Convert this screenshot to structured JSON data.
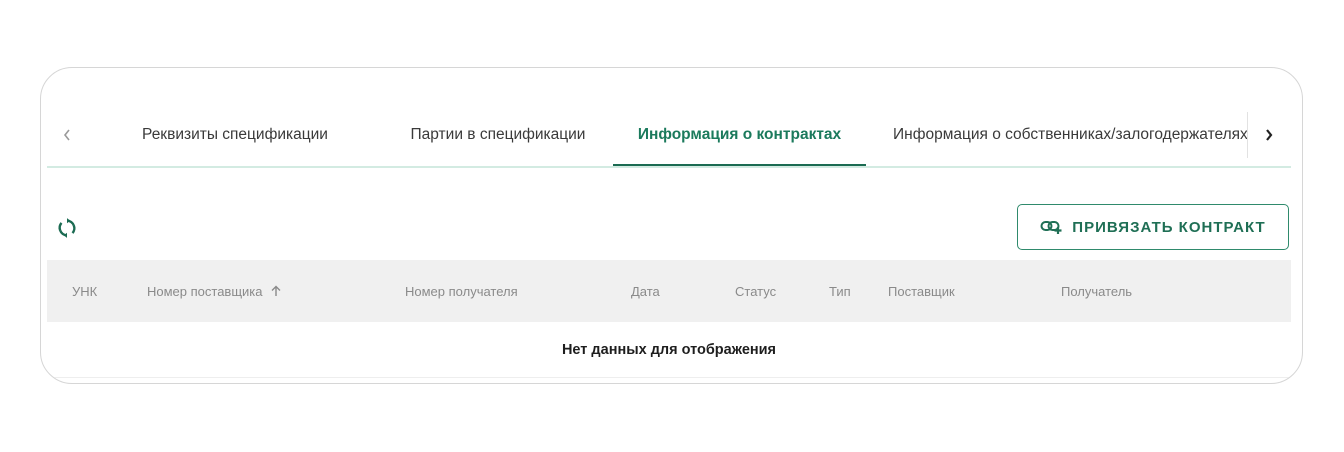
{
  "tabs": {
    "items": [
      {
        "label": "Реквизиты спецификации"
      },
      {
        "label": "Партии в спецификации"
      },
      {
        "label": "Информация о контрактах"
      },
      {
        "label": "Информация о собственниках/залогодержателях/за"
      }
    ],
    "active_index": 2,
    "left_arrow_icon": "chevron-left-icon",
    "right_arrow_icon": "chevron-right-icon"
  },
  "toolbar": {
    "refresh_icon": "refresh-icon",
    "link_contract_label": "ПРИВЯЗАТЬ КОНТРАКТ",
    "link_contract_icon": "link-add-icon"
  },
  "table": {
    "columns": [
      {
        "label": "УНК"
      },
      {
        "label": "Номер поставщика",
        "sort": "asc"
      },
      {
        "label": "Номер получателя"
      },
      {
        "label": "Дата"
      },
      {
        "label": "Статус"
      },
      {
        "label": "Тип"
      },
      {
        "label": "Поставщик"
      },
      {
        "label": "Получатель"
      }
    ],
    "sort_icon": "arrow-up-icon",
    "empty_text": "Нет данных для отображения"
  },
  "colors": {
    "accent": "#1b7a5c",
    "accent_dark": "#1b6b52",
    "header_bg": "#f0f0f0"
  }
}
